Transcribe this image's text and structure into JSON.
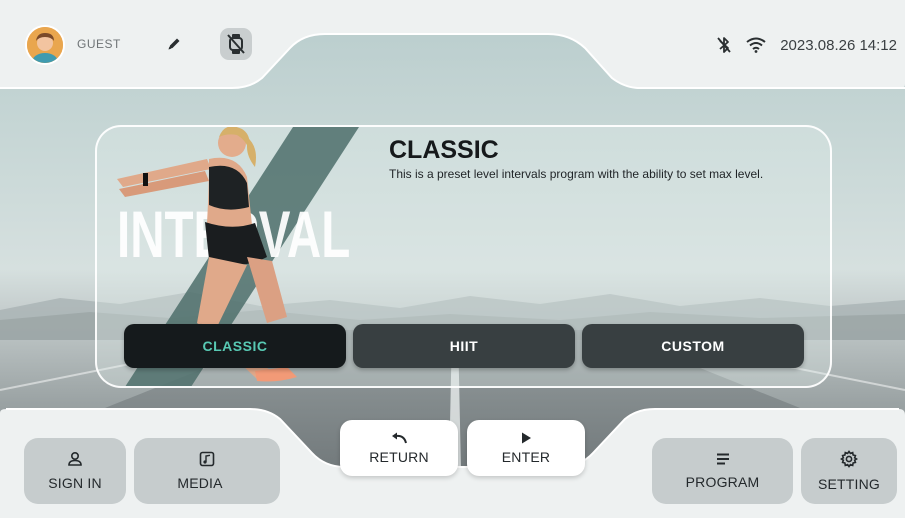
{
  "header": {
    "user_name": "GUEST",
    "datetime": "2023.08.26 14:12",
    "icons": {
      "avatar": "user-avatar",
      "edit": "pencil-icon",
      "watch": "watch-disconnected-icon",
      "bluetooth": "bluetooth-off-icon",
      "wifi": "wifi-icon"
    }
  },
  "program": {
    "category_word": "INTERVAL",
    "title": "CLASSIC",
    "description": "This is a preset level intervals program with the ability to set max level.",
    "tabs": [
      {
        "label": "CLASSIC",
        "selected": true
      },
      {
        "label": "HIIT",
        "selected": false
      },
      {
        "label": "CUSTOM",
        "selected": false
      }
    ]
  },
  "footer": {
    "sign_in": "SIGN IN",
    "media": "MEDIA",
    "return": "RETURN",
    "enter": "ENTER",
    "program": "PROGRAM",
    "setting": "SETTING"
  },
  "colors": {
    "accent": "#58c9b3",
    "tab_bg": "#383f41",
    "tab_active_bg": "#151a1c",
    "bar_bg": "#eef1f1"
  }
}
